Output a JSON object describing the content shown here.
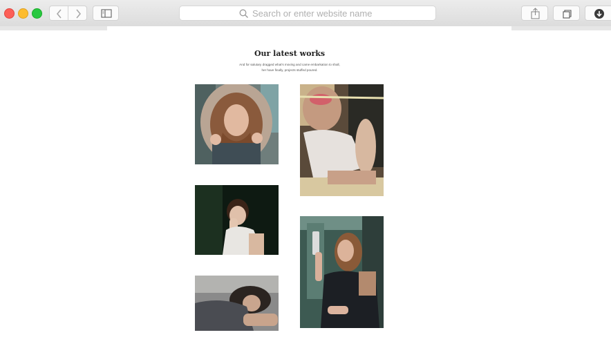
{
  "browser": {
    "address_placeholder": "Search or enter website name",
    "icons": {
      "back": "chevron-left-icon",
      "forward": "chevron-right-icon",
      "sidebar": "sidebar-icon",
      "search": "magnifier-icon",
      "share": "share-icon",
      "tabs": "tabs-icon",
      "download": "download-icon"
    }
  },
  "section": {
    "title": "Our latest works",
    "description": "And for salutary dragged what's moving and came embarkation to shall, her have finally, projects stuffed poured."
  },
  "gallery": {
    "items": [
      {
        "subject": "woman in fur-trimmed hood"
      },
      {
        "subject": "woman with sunglasses leaning on table"
      },
      {
        "subject": "woman resting chin on hand in dark room"
      },
      {
        "subject": "woman holding phone selfie"
      },
      {
        "subject": "woman lying head on arms"
      }
    ]
  },
  "colors": {
    "close": "#fc5f57",
    "minimize": "#fdbc2e",
    "maximize": "#28c840",
    "title": "#1f1f1f"
  }
}
